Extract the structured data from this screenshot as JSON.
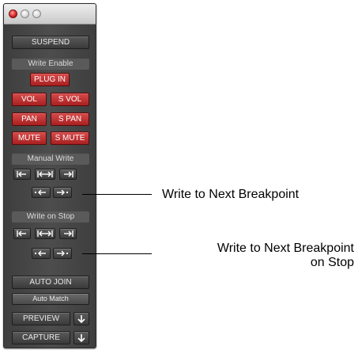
{
  "window": {
    "suspend_label": "SUSPEND",
    "write_enable": {
      "header": "Write Enable",
      "plugin_label": "PLUG IN",
      "vol_label": "VOL",
      "svol_label": "S VOL",
      "pan_label": "PAN",
      "span_label": "S PAN",
      "mute_label": "MUTE",
      "smute_label": "S MUTE"
    },
    "manual_write": {
      "header": "Manual Write"
    },
    "write_on_stop": {
      "header": "Write on Stop"
    },
    "auto_join_label": "AUTO JOIN",
    "auto_match_label": "Auto Match",
    "preview_label": "PREVIEW",
    "capture_label": "CAPTURE"
  },
  "icons": {
    "write_to_start": "write-to-start-icon",
    "write_to_all": "write-to-all-icon",
    "write_to_end": "write-to-end-icon",
    "write_to_previous_breakpoint": "write-to-previous-breakpoint-icon",
    "write_to_next_breakpoint": "write-to-next-breakpoint-icon",
    "punch_down": "down-arrow-icon"
  },
  "callouts": {
    "next_breakpoint": "Write to Next Breakpoint",
    "next_breakpoint_on_stop_line1": "Write to Next Breakpoint",
    "next_breakpoint_on_stop_line2": "on Stop"
  },
  "colors": {
    "enabled_red": "#c03030",
    "panel_gray": "#4a4a4a"
  }
}
